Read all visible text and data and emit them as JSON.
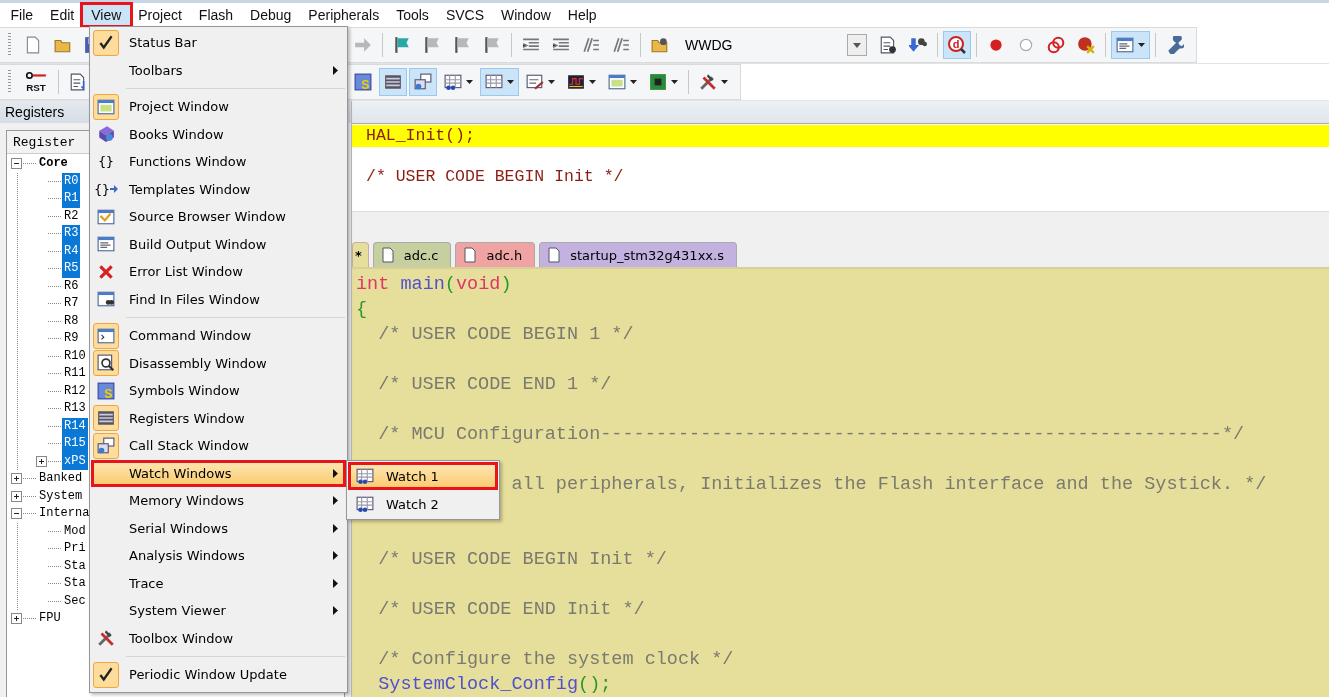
{
  "menubar": [
    {
      "label": "File",
      "selected": false,
      "outlined": false
    },
    {
      "label": "Edit",
      "selected": false,
      "outlined": false
    },
    {
      "label": "View",
      "selected": true,
      "outlined": true
    },
    {
      "label": "Project",
      "selected": false,
      "outlined": false
    },
    {
      "label": "Flash",
      "selected": false,
      "outlined": false
    },
    {
      "label": "Debug",
      "selected": false,
      "outlined": false
    },
    {
      "label": "Peripherals",
      "selected": false,
      "outlined": false
    },
    {
      "label": "Tools",
      "selected": false,
      "outlined": false
    },
    {
      "label": "SVCS",
      "selected": false,
      "outlined": false
    },
    {
      "label": "Window",
      "selected": false,
      "outlined": false
    },
    {
      "label": "Help",
      "selected": false,
      "outlined": false
    }
  ],
  "toolbar_1": {
    "left": [
      {
        "kind": "grip"
      },
      {
        "kind": "button",
        "on": false
      },
      {
        "kind": "button",
        "on": false
      },
      {
        "kind": "button",
        "on": false
      }
    ],
    "right": [
      {
        "kind": "button",
        "on": false
      },
      {
        "kind": "separator"
      },
      {
        "kind": "button",
        "on": false
      },
      {
        "kind": "button",
        "on": false
      },
      {
        "kind": "button",
        "on": false
      },
      {
        "kind": "button",
        "on": false
      },
      {
        "kind": "separator"
      },
      {
        "kind": "button",
        "on": false
      },
      {
        "kind": "button",
        "on": false
      },
      {
        "kind": "button",
        "on": false
      },
      {
        "kind": "button",
        "on": false
      },
      {
        "kind": "separator"
      },
      {
        "kind": "button",
        "on": false
      },
      {
        "kind": "combo",
        "value": "WWDG"
      },
      {
        "kind": "button",
        "on": false
      },
      {
        "kind": "button",
        "on": false
      },
      {
        "kind": "separator"
      },
      {
        "kind": "button",
        "on": true,
        "label": "d"
      },
      {
        "kind": "separator"
      },
      {
        "kind": "button",
        "on": false
      },
      {
        "kind": "button",
        "on": false
      },
      {
        "kind": "button",
        "on": false
      },
      {
        "kind": "button",
        "on": false
      },
      {
        "kind": "separator"
      },
      {
        "kind": "button",
        "on": true,
        "caret": true
      },
      {
        "kind": "separator"
      },
      {
        "kind": "button",
        "on": false
      }
    ]
  },
  "toolbar_2": {
    "left": [
      {
        "kind": "grip"
      },
      {
        "kind": "button",
        "on": false,
        "label": "RST"
      },
      {
        "kind": "separator"
      },
      {
        "kind": "button",
        "on": false
      }
    ],
    "right": [
      {
        "kind": "button",
        "on": false,
        "label": "S"
      },
      {
        "kind": "button",
        "on": true
      },
      {
        "kind": "button",
        "on": true
      },
      {
        "kind": "button",
        "on": false,
        "caret": true
      },
      {
        "kind": "button",
        "on": true,
        "caret": true
      },
      {
        "kind": "button",
        "on": false,
        "caret": true
      },
      {
        "kind": "button",
        "on": false,
        "caret": true
      },
      {
        "kind": "button",
        "on": false,
        "caret": true
      },
      {
        "kind": "button",
        "on": false,
        "caret": true
      },
      {
        "kind": "separator"
      },
      {
        "kind": "button",
        "on": false,
        "caret": true
      }
    ]
  },
  "registers_panel": {
    "title": "Registers",
    "column": "Register",
    "tree": [
      {
        "label": "Core",
        "emphasis": true,
        "expanded": true,
        "selected": false,
        "children": [
          {
            "label": "R0",
            "selected": true
          },
          {
            "label": "R1",
            "selected": true
          },
          {
            "label": "R2",
            "selected": false
          },
          {
            "label": "R3",
            "selected": true
          },
          {
            "label": "R4",
            "selected": true
          },
          {
            "label": "R5",
            "selected": true
          },
          {
            "label": "R6",
            "selected": false
          },
          {
            "label": "R7",
            "selected": false
          },
          {
            "label": "R8",
            "selected": false
          },
          {
            "label": "R9",
            "selected": false
          },
          {
            "label": "R10",
            "selected": false
          },
          {
            "label": "R11",
            "selected": false
          },
          {
            "label": "R12",
            "selected": false
          },
          {
            "label": "R13",
            "selected": false
          },
          {
            "label": "R14",
            "selected": true
          },
          {
            "label": "R15",
            "selected": true
          },
          {
            "label": "xPS",
            "selected": true,
            "expanded": false
          }
        ]
      },
      {
        "label": "Banked",
        "selected": false,
        "expanded": false
      },
      {
        "label": "System",
        "selected": false,
        "expanded": false
      },
      {
        "label": "Interna",
        "selected": false,
        "expanded": true,
        "children": [
          {
            "label": "Mod",
            "selected": false
          },
          {
            "label": "Pri",
            "selected": false
          },
          {
            "label": "Sta",
            "selected": false
          },
          {
            "label": "Sta",
            "selected": false
          },
          {
            "label": "Sec",
            "selected": false
          }
        ]
      },
      {
        "label": "FPU",
        "selected": false,
        "expanded": false
      }
    ]
  },
  "upper_editor": {
    "lines": [
      {
        "kind": "code",
        "current": true,
        "tokens": [
          {
            "text": "HAL_Init();",
            "kind": "plain"
          }
        ]
      },
      {
        "kind": "blank"
      },
      {
        "kind": "code",
        "current": false,
        "tokens": [
          {
            "text": "/* USER CODE BEGIN Init */",
            "kind": "plain"
          }
        ]
      }
    ]
  },
  "tabs": [
    {
      "label": "*",
      "selected": true,
      "color": "#e6df9b"
    },
    {
      "label": "adc.c",
      "selected": false,
      "color": "#c5cf9f"
    },
    {
      "label": "adc.h",
      "selected": false,
      "color": "#efa3a3"
    },
    {
      "label": "startup_stm32g431xx.s",
      "selected": false,
      "color": "#c3b2e0"
    }
  ],
  "editor": {
    "lines": [
      {
        "kind": "code",
        "tokens": [
          {
            "text": "int ",
            "kind": "keyword"
          },
          {
            "text": "main",
            "kind": "function"
          },
          {
            "text": "(",
            "kind": "punct"
          },
          {
            "text": "void",
            "kind": "keyword"
          },
          {
            "text": ")",
            "kind": "punct"
          }
        ]
      },
      {
        "kind": "code",
        "tokens": [
          {
            "text": "{",
            "kind": "punct"
          }
        ]
      },
      {
        "kind": "code",
        "indent": true,
        "tokens": [
          {
            "text": "/* USER CODE BEGIN 1 */",
            "kind": "comment"
          }
        ]
      },
      {
        "kind": "blank"
      },
      {
        "kind": "code",
        "indent": true,
        "tokens": [
          {
            "text": "/* USER CODE END 1 */",
            "kind": "comment"
          }
        ]
      },
      {
        "kind": "blank"
      },
      {
        "kind": "code",
        "indent": true,
        "tokens": [
          {
            "text": "/* MCU Configuration--------------------------------------------------------*/",
            "kind": "comment"
          }
        ]
      },
      {
        "kind": "blank"
      },
      {
        "kind": "code",
        "indent": true,
        "covered": true,
        "tokens": [
          {
            "text": "all peripherals, Initializes the Flash interface and the Systick. */",
            "kind": "comment"
          }
        ]
      },
      {
        "kind": "blank"
      },
      {
        "kind": "blank"
      },
      {
        "kind": "code",
        "indent": true,
        "tokens": [
          {
            "text": "/* USER CODE BEGIN Init */",
            "kind": "comment"
          }
        ]
      },
      {
        "kind": "blank"
      },
      {
        "kind": "code",
        "indent": true,
        "tokens": [
          {
            "text": "/* USER CODE END Init */",
            "kind": "comment"
          }
        ]
      },
      {
        "kind": "blank"
      },
      {
        "kind": "code",
        "indent": true,
        "tokens": [
          {
            "text": "/* Configure the system clock */",
            "kind": "comment"
          }
        ]
      },
      {
        "kind": "code",
        "indent": true,
        "tokens": [
          {
            "text": "SystemClock_Config",
            "kind": "function"
          },
          {
            "text": "();",
            "kind": "punct"
          }
        ]
      }
    ]
  },
  "view_menu": {
    "items": [
      {
        "kind": "item",
        "label": "Status Bar",
        "checked": true,
        "submenu": false,
        "selected": false,
        "outlined": false
      },
      {
        "kind": "item",
        "label": "Toolbars",
        "checked": false,
        "submenu": true,
        "selected": false,
        "outlined": false
      },
      {
        "kind": "separator"
      },
      {
        "kind": "item",
        "label": "Project Window",
        "checked": true,
        "submenu": false,
        "selected": false,
        "outlined": false
      },
      {
        "kind": "item",
        "label": "Books Window",
        "checked": false,
        "submenu": false,
        "selected": false,
        "outlined": false
      },
      {
        "kind": "item",
        "label": "Functions Window",
        "glyph": "{}",
        "checked": false,
        "submenu": false,
        "selected": false,
        "outlined": false
      },
      {
        "kind": "item",
        "label": "Templates Window",
        "glyph": "{}",
        "checked": false,
        "submenu": false,
        "selected": false,
        "outlined": false
      },
      {
        "kind": "item",
        "label": "Source Browser Window",
        "checked": false,
        "submenu": false,
        "selected": false,
        "outlined": false
      },
      {
        "kind": "item",
        "label": "Build Output Window",
        "checked": false,
        "submenu": false,
        "selected": false,
        "outlined": false
      },
      {
        "kind": "item",
        "label": "Error List Window",
        "checked": false,
        "submenu": false,
        "selected": false,
        "outlined": false
      },
      {
        "kind": "item",
        "label": "Find In Files Window",
        "checked": false,
        "submenu": false,
        "selected": false,
        "outlined": false
      },
      {
        "kind": "separator"
      },
      {
        "kind": "item",
        "label": "Command Window",
        "checked": true,
        "submenu": false,
        "selected": false,
        "outlined": false
      },
      {
        "kind": "item",
        "label": "Disassembly Window",
        "checked": true,
        "submenu": false,
        "selected": false,
        "outlined": false
      },
      {
        "kind": "item",
        "label": "Symbols Window",
        "glyph": "S",
        "checked": false,
        "submenu": false,
        "selected": false,
        "outlined": false
      },
      {
        "kind": "item",
        "label": "Registers Window",
        "checked": true,
        "submenu": false,
        "selected": false,
        "outlined": false
      },
      {
        "kind": "item",
        "label": "Call Stack Window",
        "checked": true,
        "submenu": false,
        "selected": false,
        "outlined": false
      },
      {
        "kind": "item",
        "label": "Watch Windows",
        "checked": false,
        "submenu": true,
        "selected": true,
        "outlined": true
      },
      {
        "kind": "item",
        "label": "Memory Windows",
        "checked": false,
        "submenu": true,
        "selected": false,
        "outlined": false
      },
      {
        "kind": "item",
        "label": "Serial Windows",
        "checked": false,
        "submenu": true,
        "selected": false,
        "outlined": false
      },
      {
        "kind": "item",
        "label": "Analysis Windows",
        "checked": false,
        "submenu": true,
        "selected": false,
        "outlined": false
      },
      {
        "kind": "item",
        "label": "Trace",
        "checked": false,
        "submenu": true,
        "selected": false,
        "outlined": false
      },
      {
        "kind": "item",
        "label": "System Viewer",
        "checked": false,
        "submenu": true,
        "selected": false,
        "outlined": false
      },
      {
        "kind": "item",
        "label": "Toolbox Window",
        "checked": false,
        "submenu": false,
        "selected": false,
        "outlined": false
      },
      {
        "kind": "separator"
      },
      {
        "kind": "item",
        "label": "Periodic Window Update",
        "checked": true,
        "submenu": false,
        "selected": false,
        "outlined": false
      }
    ]
  },
  "watch_submenu": {
    "items": [
      {
        "label": "Watch 1",
        "selected": true,
        "outlined": true
      },
      {
        "label": "Watch 2",
        "selected": false,
        "outlined": false
      }
    ]
  }
}
